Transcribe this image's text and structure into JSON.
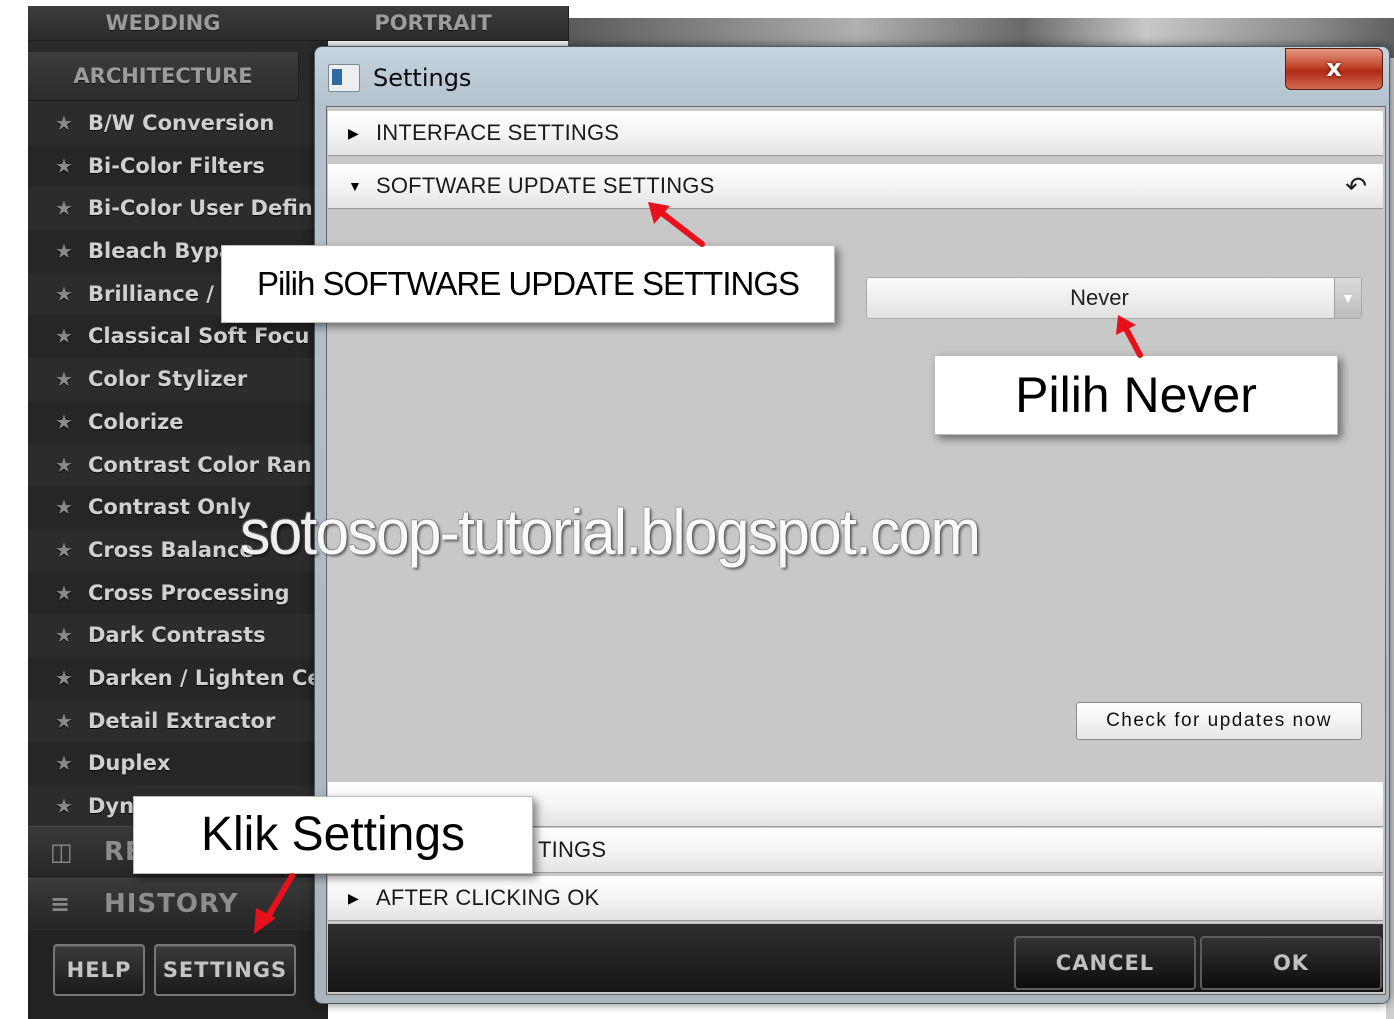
{
  "left_panel": {
    "tabs": [
      "WEDDING",
      "PORTRAIT",
      "ARCHITECTURE"
    ],
    "filters": [
      "B/W Conversion",
      "Bi-Color Filters",
      "Bi-Color User Defin",
      "Bleach Bypa",
      "Brilliance / W",
      "Classical Soft Focu",
      "Color Stylizer",
      "Colorize",
      "Contrast Color Ran",
      "Contrast Only",
      "Cross Balance",
      "Cross Processing",
      "Dark Contrasts",
      "Darken / Lighten Ce",
      "Detail Extractor",
      "Duplex",
      "Dyn"
    ],
    "recent_label": "RE",
    "history_label": "HISTORY",
    "help_label": "HELP",
    "settings_label": "SETTINGS"
  },
  "dialog": {
    "title": "Settings",
    "close_label": "x",
    "sections": {
      "interface": "INTERFACE SETTINGS",
      "software_update": "SOFTWARE UPDATE SETTINGS",
      "third_partial": "TINGS",
      "after_ok": "AFTER CLICKING OK"
    },
    "update_frequency_value": "Never",
    "check_updates_label": "Check for updates now",
    "cancel_label": "CANCEL",
    "ok_label": "OK"
  },
  "annotations": {
    "update_callout": "Pilih SOFTWARE UPDATE SETTINGS",
    "never_callout": "Pilih Never",
    "settings_callout": "Klik Settings",
    "watermark": "sotosop-tutorial.blogspot.com"
  },
  "colors": {
    "arrow": "#e8101a",
    "close_button": "#c4442a",
    "panel_bg": "#2a2a2a"
  }
}
